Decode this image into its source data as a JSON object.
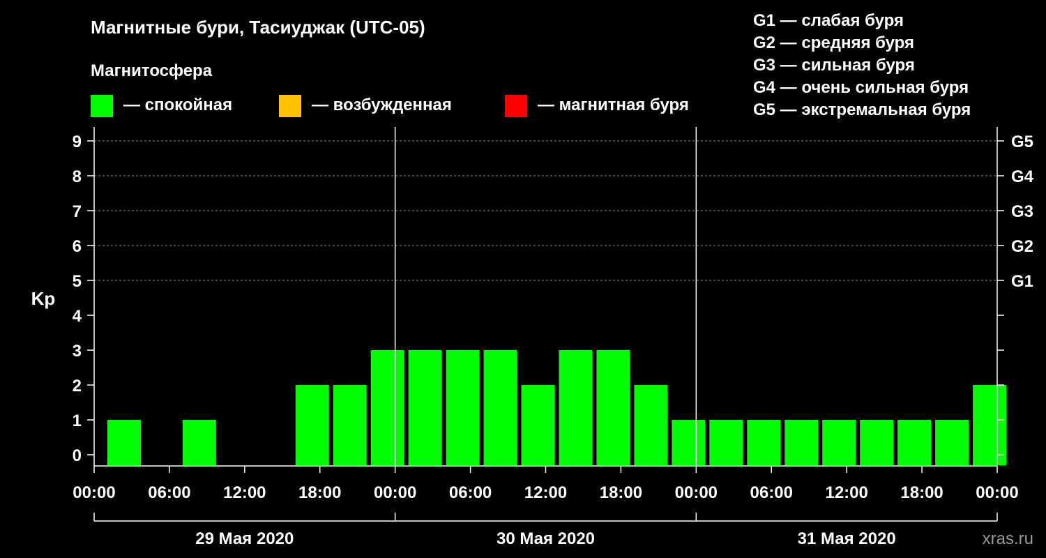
{
  "title": "Магнитные бури, Тасиуджак (UTC-05)",
  "subtitle": "Магнитосфера",
  "legend": [
    {
      "label": "— спокойная",
      "color": "#00ff00"
    },
    {
      "label": "— возбужденная",
      "color": "#ffc000"
    },
    {
      "label": "— магнитная буря",
      "color": "#ff0000"
    }
  ],
  "storm_legend": [
    "G1 — слабая буря",
    "G2 — средняя буря",
    "G3 — сильная буря",
    "G4 — очень сильная буря",
    "G5 — экстремальная буря"
  ],
  "watermark": "xras.ru",
  "chart_data": {
    "type": "bar",
    "ylabel": "Kp",
    "ylim": [
      0,
      9
    ],
    "y_ticks": [
      "0",
      "1",
      "2",
      "3",
      "4",
      "5",
      "6",
      "7",
      "8",
      "9"
    ],
    "right_ticks": [
      {
        "kp": 5,
        "label": "G1"
      },
      {
        "kp": 6,
        "label": "G2"
      },
      {
        "kp": 7,
        "label": "G3"
      },
      {
        "kp": 8,
        "label": "G4"
      },
      {
        "kp": 9,
        "label": "G5"
      }
    ],
    "x_hours_range": [
      0,
      72
    ],
    "x_ticks": [
      "00:00",
      "06:00",
      "12:00",
      "18:00",
      "00:00",
      "06:00",
      "12:00",
      "18:00",
      "00:00",
      "06:00",
      "12:00",
      "18:00",
      "00:00"
    ],
    "days": [
      "29 Мая 2020",
      "30 Мая 2020",
      "31 Мая 2020"
    ],
    "grid": "dashed horizontal lines at Kp 5–9",
    "bars": [
      {
        "start_hour": 1,
        "kp": 1
      },
      {
        "start_hour": 4,
        "kp": 0
      },
      {
        "start_hour": 7,
        "kp": 1
      },
      {
        "start_hour": 10,
        "kp": 0
      },
      {
        "start_hour": 13,
        "kp": 0
      },
      {
        "start_hour": 16,
        "kp": 2
      },
      {
        "start_hour": 19,
        "kp": 2
      },
      {
        "start_hour": 22,
        "kp": 3
      },
      {
        "start_hour": 25,
        "kp": 3
      },
      {
        "start_hour": 28,
        "kp": 3
      },
      {
        "start_hour": 31,
        "kp": 3
      },
      {
        "start_hour": 34,
        "kp": 2
      },
      {
        "start_hour": 37,
        "kp": 3
      },
      {
        "start_hour": 40,
        "kp": 3
      },
      {
        "start_hour": 43,
        "kp": 2
      },
      {
        "start_hour": 46,
        "kp": 1
      },
      {
        "start_hour": 49,
        "kp": 1
      },
      {
        "start_hour": 52,
        "kp": 1
      },
      {
        "start_hour": 55,
        "kp": 1
      },
      {
        "start_hour": 58,
        "kp": 1
      },
      {
        "start_hour": 61,
        "kp": 1
      },
      {
        "start_hour": 64,
        "kp": 1
      },
      {
        "start_hour": 67,
        "kp": 1
      },
      {
        "start_hour": 70,
        "kp": 2
      }
    ]
  }
}
